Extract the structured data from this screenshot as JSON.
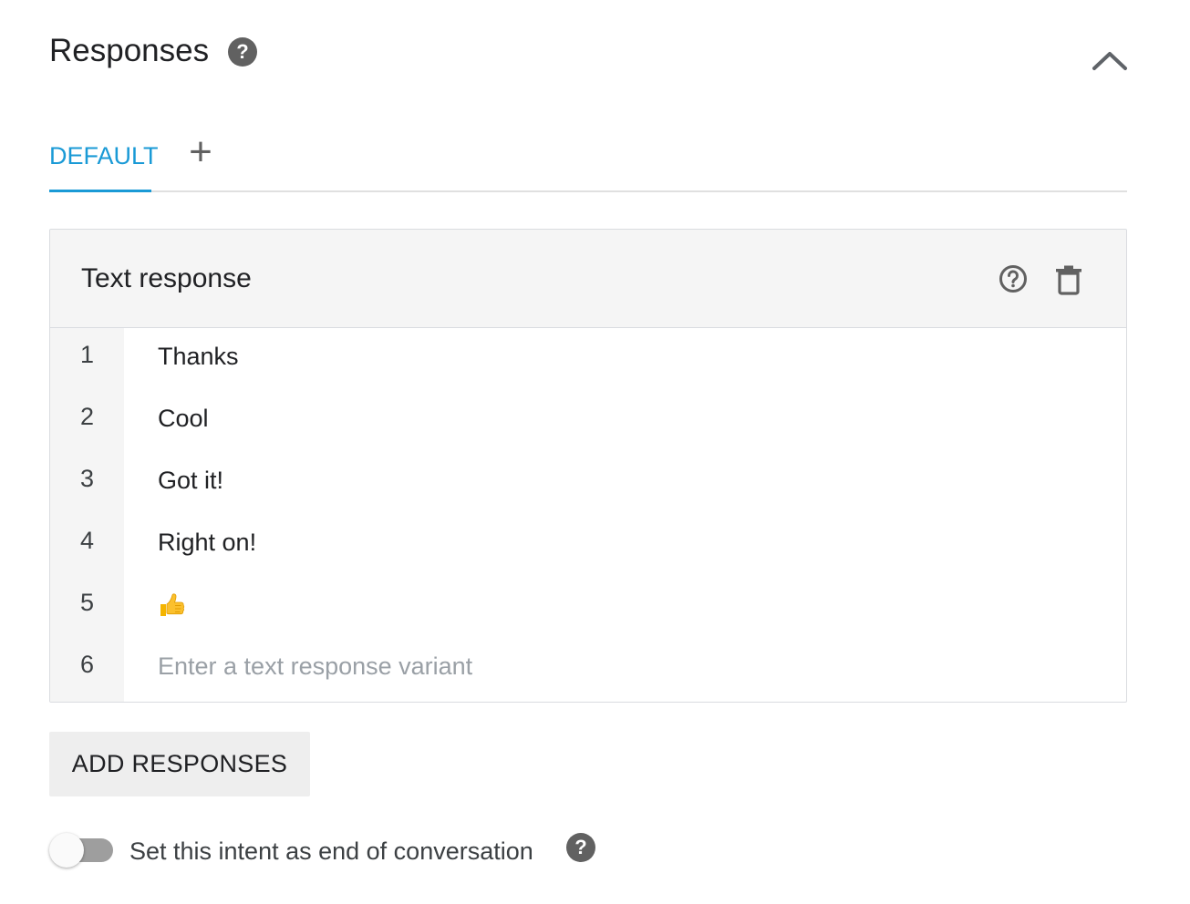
{
  "section": {
    "title": "Responses",
    "help_icon": "help-circle-filled-icon",
    "collapse_icon": "chevron-up-icon"
  },
  "tabs": {
    "items": [
      {
        "label": "DEFAULT",
        "active": true
      }
    ],
    "add_icon": "plus-icon",
    "active_color": "#1a9ad6"
  },
  "card": {
    "title": "Text response",
    "help_icon": "help-circle-outline-icon",
    "delete_icon": "trash-icon",
    "rows": [
      {
        "number": "1",
        "text": "Thanks"
      },
      {
        "number": "2",
        "text": "Cool"
      },
      {
        "number": "3",
        "text": "Got it!"
      },
      {
        "number": "4",
        "text": "Right on!"
      },
      {
        "number": "5",
        "text": "",
        "icon": "thumbs-up-emoji"
      },
      {
        "number": "6",
        "text": "",
        "placeholder": "Enter a text response variant"
      }
    ]
  },
  "add_button": {
    "label": "ADD RESPONSES"
  },
  "end_conversation": {
    "label": "Set this intent as end of conversation",
    "enabled": false,
    "help_icon": "help-circle-filled-icon"
  }
}
